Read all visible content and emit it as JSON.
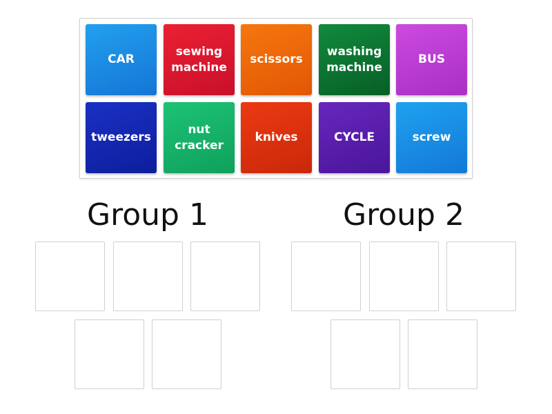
{
  "cards": [
    {
      "label": "CAR",
      "color": "#1a8fe3"
    },
    {
      "label": "sewing machine",
      "color": "#e0172b"
    },
    {
      "label": "scissors",
      "color": "#f06a0a"
    },
    {
      "label": "washing machine",
      "color": "#0d7a34"
    },
    {
      "label": "BUS",
      "color": "#c33fd8"
    },
    {
      "label": "tweezers",
      "color": "#1428b4"
    },
    {
      "label": "nut cracker",
      "color": "#17b56a"
    },
    {
      "label": "knives",
      "color": "#e3320f"
    },
    {
      "label": "CYCLE",
      "color": "#5a1fb0"
    },
    {
      "label": "screw",
      "color": "#1a93e6"
    }
  ],
  "groups": [
    {
      "title": "Group 1",
      "slots": 5
    },
    {
      "title": "Group 2",
      "slots": 5
    }
  ]
}
